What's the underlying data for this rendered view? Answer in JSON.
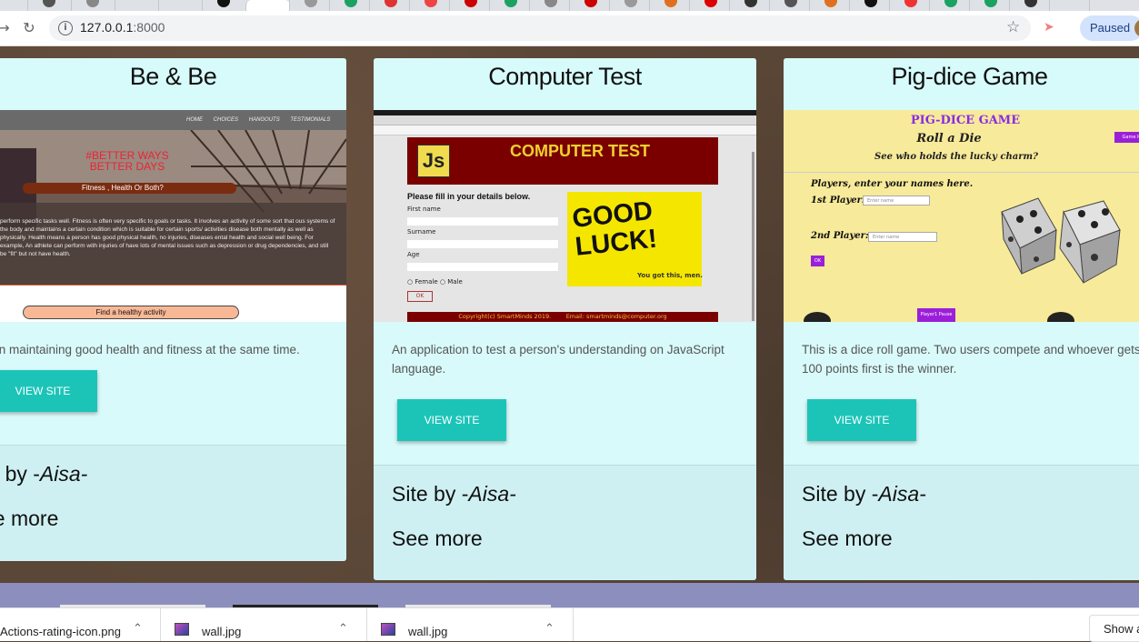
{
  "browser": {
    "url_host": "127.0.0.1",
    "url_port": ":8000",
    "profile_label": "Paused"
  },
  "cards": [
    {
      "title": "Be & Be",
      "description": "e on maintaining good health and fitness at the same time.",
      "button_label": "VIEW SITE",
      "site_by_prefix": "te by -",
      "site_by_author": "Aisa-",
      "see_more": "ee more",
      "screenshot": {
        "nav": [
          "HOME",
          "CHOICES",
          "HANGOUTS",
          "TESTIMONIALS"
        ],
        "headline": "#BETTER WAYS BETTER DAYS",
        "subheadline": "Fitness , Health Or Both?",
        "body_text": "perform specific tasks well. Fitness is often very specific to goals or tasks. It involves an activity of some sort that ous systems of the body and maintains a certain condition which is suitable for certain sports/ activities disease both mentally as well as physically. Health means a person has good physical health, no injuries, diseases ental health and social well being. For example, An athlete can perform with injuries of have lots of mental issues such as depression or drug dependencies, and still be \"fit\" but not have health.",
        "cta": "Find a healthy activity"
      }
    },
    {
      "title": "Computer Test",
      "description": "An application to test a person's understanding on JavaScript language.",
      "button_label": "VIEW SITE",
      "site_by_prefix": "Site by -",
      "site_by_author": "Aisa-",
      "see_more": "See more",
      "screenshot": {
        "banner": "COMPUTER TEST",
        "js_logo": "Js",
        "form_title": "Please fill in your details below.",
        "fields": [
          "First name",
          "Surname",
          "Age"
        ],
        "gender_options": [
          "Female",
          "Male"
        ],
        "ok": "OK",
        "good_luck": "GOOD LUCK!",
        "good_luck_sub": "You got this, men.",
        "footer": "Copyright(c) SmartMinds 2019.        Email: smartminds@computer.org"
      }
    },
    {
      "title": "Pig-dice Game",
      "description": "This is a dice roll game. Two users compete and whoever gets 100 points first is the winner.",
      "button_label": "VIEW SITE",
      "site_by_prefix": "Site by -",
      "site_by_author": "Aisa-",
      "see_more": "See more",
      "screenshot": {
        "title": "PIG-DICE GAME",
        "subtitle": "Roll a Die",
        "tagline": "See who holds the lucky charm?",
        "prompt": "Players, enter your names here.",
        "player1_label": "1st Player:",
        "player2_label": "2nd Player:",
        "placeholder1": "Enter name",
        "placeholder2": "Enter name",
        "ok": "OK",
        "rules": "Game Ru",
        "bottom_button": "Player1 Pause"
      }
    }
  ],
  "downloads": [
    {
      "name": "Actions-rating-icon.png"
    },
    {
      "name": "wall.jpg"
    },
    {
      "name": "wall.jpg"
    }
  ],
  "downloads_show_all": "Show a"
}
